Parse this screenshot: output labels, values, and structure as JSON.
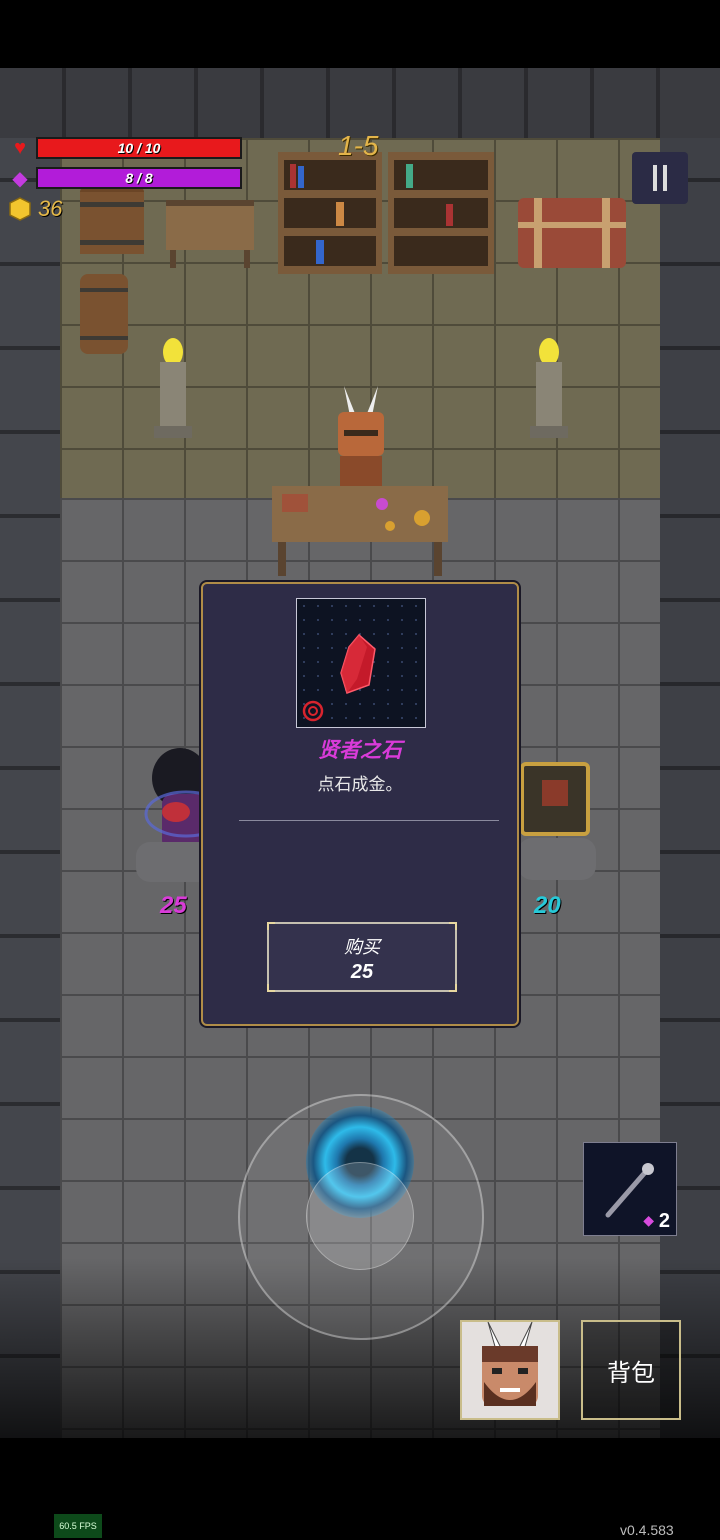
{
  "hud": {
    "hp_text": "10 / 10",
    "hp_fraction": 1.0,
    "mana_text": "8 / 8",
    "mana_fraction": 1.0,
    "gold": "36",
    "level": "1-5"
  },
  "shop": {
    "left_price": "25",
    "right_price": "20"
  },
  "item_popup": {
    "name": "贤者之石",
    "description": "点石成金。",
    "buy_label": "购买",
    "buy_price": "25"
  },
  "controls": {
    "skill_cost": "2",
    "bag_label": "背包"
  },
  "footer": {
    "fps": "60.5 FPS",
    "version": "v0.4.583"
  },
  "colors": {
    "hp": "#e8191c",
    "mana": "#b21cd9",
    "gold": "#e5b94a",
    "item_name": "#d93bd9",
    "left_price": "#d93bd9",
    "right_price": "#27c9d8"
  }
}
